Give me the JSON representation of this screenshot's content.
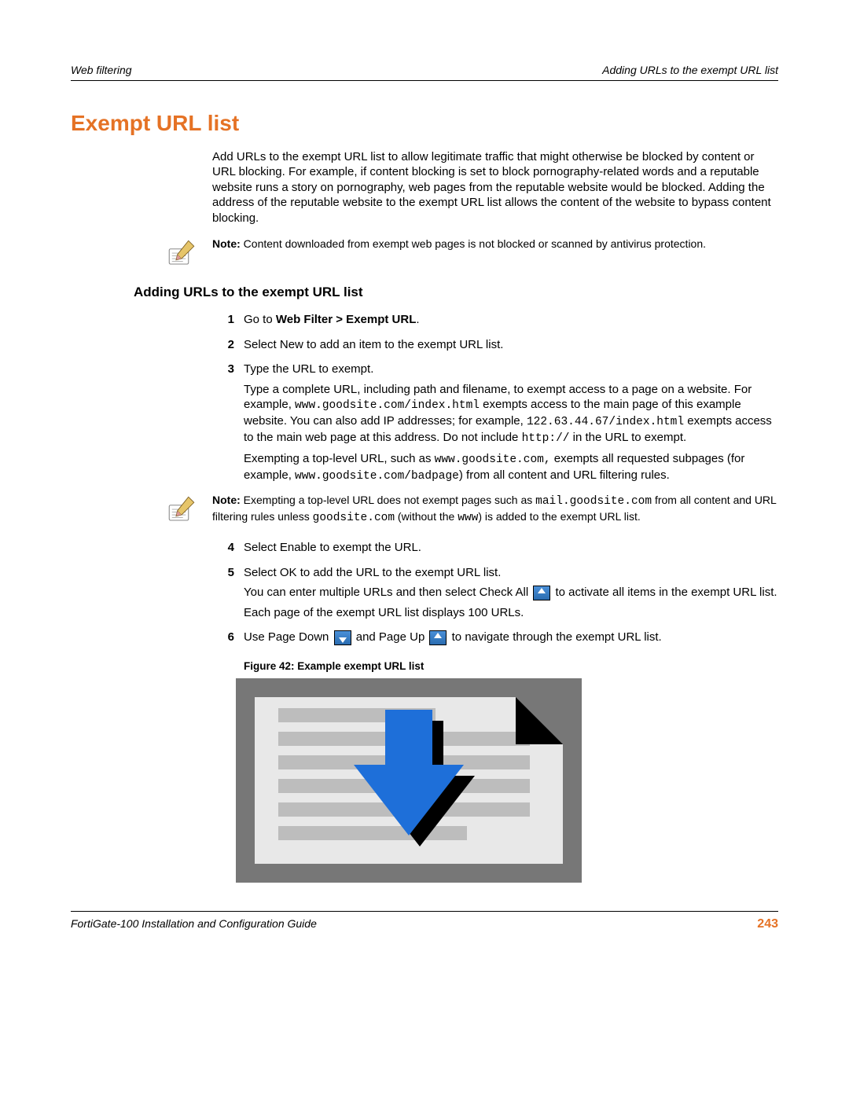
{
  "header": {
    "left": "Web filtering",
    "right": "Adding URLs to the exempt URL list"
  },
  "section_title": "Exempt URL list",
  "intro": "Add URLs to the exempt URL list to allow legitimate traffic that might otherwise be blocked by content or URL blocking. For example, if content blocking is set to block pornography-related words and a reputable website runs a story on pornography, web pages from the reputable website would be blocked. Adding the address of the reputable website to the exempt URL list allows the content of the website to bypass content blocking.",
  "note1_prefix": "Note:",
  "note1_body": " Content downloaded from exempt web pages is not blocked or scanned by antivirus protection.",
  "subheading": "Adding URLs to the exempt URL list",
  "step1": {
    "num": "1",
    "pre": "Go to ",
    "bold": "Web Filter > Exempt URL",
    "post": "."
  },
  "step2": {
    "num": "2",
    "text": "Select New to add an item to the exempt URL list."
  },
  "step3": {
    "num": "3",
    "line1": "Type the URL to exempt.",
    "p1a": "Type a complete URL, including path and filename, to exempt access to a page on a website. For example, ",
    "p1_c1": "www.goodsite.com/index.html",
    "p1b": " exempts access to the main page of this example website. You can also add IP addresses; for example, ",
    "p1_c2": "122.63.44.67/index.html",
    "p1c": " exempts access to the main web page at this address. Do not include ",
    "p1_c3": "http://",
    "p1d": " in the URL to exempt.",
    "p2a": "Exempting a top-level URL, such as ",
    "p2_c1": "www.goodsite.com,",
    "p2b": " exempts all requested subpages (for example, ",
    "p2_c2": "www.goodsite.com/badpage",
    "p2c": ") from all content and URL filtering rules."
  },
  "note2_prefix": "Note:",
  "note2_a": " Exempting a top-level URL does not exempt pages such as ",
  "note2_c1": "mail.goodsite.com",
  "note2_b": " from all content and URL filtering rules unless ",
  "note2_c2": "goodsite.com",
  "note2_c": " (without the ",
  "note2_c3": "www",
  "note2_d": ") is added to the exempt URL list.",
  "step4": {
    "num": "4",
    "text": "Select Enable to exempt the URL."
  },
  "step5": {
    "num": "5",
    "line1": "Select OK to add the URL to the exempt URL list.",
    "p1a": "You can enter multiple URLs and then select Check All ",
    "p1b": " to activate all items in the exempt URL list.",
    "p2": "Each page of the exempt URL list displays 100 URLs."
  },
  "step6": {
    "num": "6",
    "a": "Use Page Down ",
    "b": " and Page Up ",
    "c": " to navigate through the exempt URL list."
  },
  "figure_caption": "Figure 42: Example exempt URL list",
  "footer": {
    "left": "FortiGate-100 Installation and Configuration Guide",
    "page": "243"
  }
}
